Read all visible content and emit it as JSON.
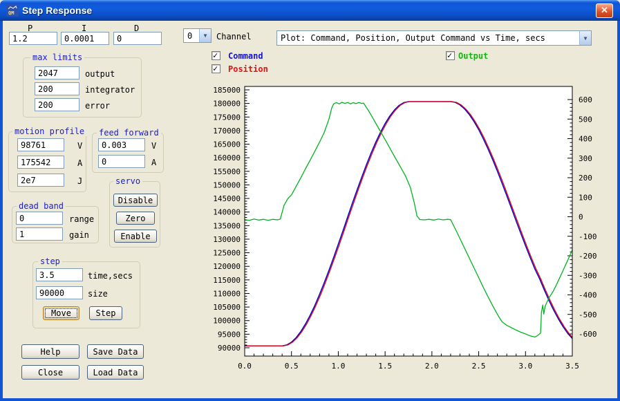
{
  "window": {
    "title": "Step Response"
  },
  "pid": {
    "p_label": "P",
    "i_label": "I",
    "d_label": "D",
    "p": "1.2",
    "i": "0.0001",
    "d": "0"
  },
  "channel": {
    "value": "0",
    "label": "Channel"
  },
  "plot_select": {
    "value": "Plot: Command, Position, Output Command vs Time, secs"
  },
  "legend": {
    "command": {
      "label": "Command",
      "checked": true,
      "color": "#1414d2"
    },
    "position": {
      "label": "Position",
      "checked": true,
      "color": "#dc1414"
    },
    "output": {
      "label": "Output",
      "checked": true,
      "color": "#14b414"
    }
  },
  "groups": {
    "max_limits": {
      "title": "max limits",
      "fields": [
        {
          "value": "2047",
          "label": "output"
        },
        {
          "value": "200",
          "label": "integrator"
        },
        {
          "value": "200",
          "label": "error"
        }
      ]
    },
    "motion_profile": {
      "title": "motion profile",
      "fields": [
        {
          "value": "98761",
          "label": "V"
        },
        {
          "value": "175542",
          "label": "A"
        },
        {
          "value": "2e7",
          "label": "J"
        }
      ]
    },
    "feed_forward": {
      "title": "feed forward",
      "fields": [
        {
          "value": "0.003",
          "label": "V"
        },
        {
          "value": "0",
          "label": "A"
        }
      ]
    },
    "servo": {
      "title": "servo",
      "buttons": [
        "Disable",
        "Zero",
        "Enable"
      ]
    },
    "dead_band": {
      "title": "dead band",
      "fields": [
        {
          "value": "0",
          "label": "range"
        },
        {
          "value": "1",
          "label": "gain"
        }
      ]
    },
    "step": {
      "title": "step",
      "fields": [
        {
          "value": "3.5",
          "label": "time,secs"
        },
        {
          "value": "90000",
          "label": "size"
        }
      ],
      "buttons": [
        "Move",
        "Step"
      ]
    }
  },
  "actions": {
    "help": "Help",
    "save": "Save Data",
    "close": "Close",
    "load": "Load Data"
  },
  "chart_data": {
    "type": "line",
    "title": "Command, Position, Output Command vs Time, secs",
    "x_axis": {
      "min": 0,
      "max": 3.5,
      "major": 0.5,
      "minor": 0.1,
      "label_format": "fixed1"
    },
    "left_axis": {
      "min": 90000,
      "max": 185000,
      "major": 5000,
      "minor": 1000
    },
    "right_axis": {
      "min": -600,
      "max": 600,
      "major": 100,
      "minor": 20
    },
    "grid": false,
    "background": "#ffffff",
    "series": [
      {
        "name": "Command",
        "axis": "left",
        "color": "#0000cc",
        "width": 1.4,
        "xshift": 0,
        "points": [
          [
            0,
            90700
          ],
          [
            0.2,
            90700
          ],
          [
            0.4,
            90700
          ],
          [
            0.45,
            91060
          ],
          [
            0.5,
            92100
          ],
          [
            0.55,
            93780
          ],
          [
            0.6,
            96030
          ],
          [
            0.65,
            98800
          ],
          [
            0.7,
            102040
          ],
          [
            0.75,
            105690
          ],
          [
            0.8,
            109690
          ],
          [
            0.85,
            113990
          ],
          [
            0.9,
            118550
          ],
          [
            0.95,
            123280
          ],
          [
            1.0,
            128170
          ],
          [
            1.05,
            133140
          ],
          [
            1.1,
            138270
          ],
          [
            1.15,
            143220
          ],
          [
            1.2,
            148100
          ],
          [
            1.25,
            152850
          ],
          [
            1.3,
            157410
          ],
          [
            1.35,
            161710
          ],
          [
            1.4,
            165720
          ],
          [
            1.45,
            169370
          ],
          [
            1.5,
            172600
          ],
          [
            1.55,
            175370
          ],
          [
            1.6,
            177610
          ],
          [
            1.65,
            179310
          ],
          [
            1.7,
            180340
          ],
          [
            1.75,
            180700
          ],
          [
            2.2,
            180700
          ],
          [
            2.25,
            180390
          ],
          [
            2.3,
            179440
          ],
          [
            2.35,
            177910
          ],
          [
            2.4,
            175870
          ],
          [
            2.45,
            173320
          ],
          [
            2.5,
            170330
          ],
          [
            2.55,
            166930
          ],
          [
            2.6,
            163200
          ],
          [
            2.65,
            159190
          ],
          [
            2.7,
            154940
          ],
          [
            2.75,
            150510
          ],
          [
            2.8,
            145960
          ],
          [
            2.85,
            141330
          ],
          [
            2.9,
            136690
          ],
          [
            2.95,
            132080
          ],
          [
            3.0,
            127560
          ],
          [
            3.05,
            123190
          ],
          [
            3.1,
            119010
          ],
          [
            3.15,
            115420
          ],
          [
            3.2,
            111310
          ],
          [
            3.25,
            107480
          ],
          [
            3.3,
            103900
          ],
          [
            3.35,
            100660
          ],
          [
            3.4,
            97800
          ],
          [
            3.45,
            95360
          ],
          [
            3.5,
            93380
          ]
        ]
      },
      {
        "name": "Position",
        "axis": "left",
        "color": "#d80018",
        "width": 1.4,
        "xshift": 0.012,
        "points": [
          [
            0,
            90700
          ],
          [
            0.2,
            90700
          ],
          [
            0.4,
            90700
          ],
          [
            0.45,
            91060
          ],
          [
            0.5,
            92100
          ],
          [
            0.55,
            93780
          ],
          [
            0.6,
            96030
          ],
          [
            0.65,
            98800
          ],
          [
            0.7,
            102040
          ],
          [
            0.75,
            105690
          ],
          [
            0.8,
            109690
          ],
          [
            0.85,
            113990
          ],
          [
            0.9,
            118550
          ],
          [
            0.95,
            123280
          ],
          [
            1.0,
            128170
          ],
          [
            1.05,
            133140
          ],
          [
            1.1,
            138270
          ],
          [
            1.15,
            143220
          ],
          [
            1.2,
            148100
          ],
          [
            1.25,
            152850
          ],
          [
            1.3,
            157410
          ],
          [
            1.35,
            161710
          ],
          [
            1.4,
            165720
          ],
          [
            1.45,
            169370
          ],
          [
            1.5,
            172600
          ],
          [
            1.55,
            175370
          ],
          [
            1.6,
            177610
          ],
          [
            1.65,
            179310
          ],
          [
            1.7,
            180340
          ],
          [
            1.75,
            180700
          ],
          [
            2.2,
            180700
          ],
          [
            2.25,
            180390
          ],
          [
            2.3,
            179440
          ],
          [
            2.35,
            177910
          ],
          [
            2.4,
            175870
          ],
          [
            2.45,
            173320
          ],
          [
            2.5,
            170330
          ],
          [
            2.55,
            166930
          ],
          [
            2.6,
            163200
          ],
          [
            2.65,
            159190
          ],
          [
            2.7,
            154940
          ],
          [
            2.75,
            150510
          ],
          [
            2.8,
            145960
          ],
          [
            2.85,
            141330
          ],
          [
            2.9,
            136690
          ],
          [
            2.95,
            132080
          ],
          [
            3.0,
            127560
          ],
          [
            3.05,
            123190
          ],
          [
            3.1,
            119010
          ],
          [
            3.15,
            115420
          ],
          [
            3.2,
            111310
          ],
          [
            3.25,
            107480
          ],
          [
            3.3,
            103900
          ],
          [
            3.35,
            100660
          ],
          [
            3.4,
            97800
          ],
          [
            3.45,
            95360
          ],
          [
            3.5,
            93380
          ]
        ]
      },
      {
        "name": "Output",
        "axis": "right",
        "color": "#00b41e",
        "width": 1.3,
        "xshift": 0,
        "points": [
          [
            0,
            -15
          ],
          [
            0.05,
            -18
          ],
          [
            0.1,
            -12
          ],
          [
            0.15,
            -17
          ],
          [
            0.2,
            -13
          ],
          [
            0.25,
            -18
          ],
          [
            0.3,
            -13
          ],
          [
            0.35,
            -16
          ],
          [
            0.38,
            -12
          ],
          [
            0.42,
            58
          ],
          [
            0.46,
            92
          ],
          [
            0.5,
            112
          ],
          [
            0.55,
            156
          ],
          [
            0.6,
            200
          ],
          [
            0.65,
            246
          ],
          [
            0.7,
            290
          ],
          [
            0.75,
            336
          ],
          [
            0.8,
            382
          ],
          [
            0.85,
            432
          ],
          [
            0.9,
            500
          ],
          [
            0.93,
            556
          ],
          [
            0.95,
            578
          ],
          [
            0.98,
            584
          ],
          [
            1.01,
            578
          ],
          [
            1.04,
            586
          ],
          [
            1.07,
            580
          ],
          [
            1.1,
            585
          ],
          [
            1.13,
            578
          ],
          [
            1.16,
            584
          ],
          [
            1.19,
            579
          ],
          [
            1.22,
            585
          ],
          [
            1.25,
            580
          ],
          [
            1.27,
            582
          ],
          [
            1.32,
            545
          ],
          [
            1.37,
            505
          ],
          [
            1.42,
            462
          ],
          [
            1.47,
            420
          ],
          [
            1.52,
            378
          ],
          [
            1.57,
            335
          ],
          [
            1.62,
            292
          ],
          [
            1.67,
            250
          ],
          [
            1.72,
            207
          ],
          [
            1.77,
            150
          ],
          [
            1.81,
            75
          ],
          [
            1.84,
            5
          ],
          [
            1.87,
            -14
          ],
          [
            1.92,
            -16
          ],
          [
            1.97,
            -13
          ],
          [
            2.02,
            -17
          ],
          [
            2.07,
            -12
          ],
          [
            2.12,
            -16
          ],
          [
            2.17,
            -13
          ],
          [
            2.2,
            -15
          ],
          [
            2.25,
            -62
          ],
          [
            2.3,
            -112
          ],
          [
            2.35,
            -162
          ],
          [
            2.4,
            -212
          ],
          [
            2.45,
            -262
          ],
          [
            2.5,
            -312
          ],
          [
            2.55,
            -362
          ],
          [
            2.6,
            -410
          ],
          [
            2.65,
            -456
          ],
          [
            2.7,
            -500
          ],
          [
            2.75,
            -538
          ],
          [
            2.8,
            -556
          ],
          [
            2.85,
            -568
          ],
          [
            2.9,
            -580
          ],
          [
            2.95,
            -591
          ],
          [
            3.0,
            -600
          ],
          [
            3.05,
            -610
          ],
          [
            3.1,
            -616
          ],
          [
            3.12,
            -611
          ],
          [
            3.14,
            -604
          ],
          [
            3.16,
            -596
          ],
          [
            3.165,
            -560
          ],
          [
            3.17,
            -490
          ],
          [
            3.185,
            -452
          ],
          [
            3.195,
            -498
          ],
          [
            3.21,
            -458
          ],
          [
            3.25,
            -416
          ],
          [
            3.3,
            -378
          ],
          [
            3.35,
            -328
          ],
          [
            3.4,
            -276
          ],
          [
            3.45,
            -224
          ],
          [
            3.5,
            -170
          ]
        ]
      }
    ]
  }
}
